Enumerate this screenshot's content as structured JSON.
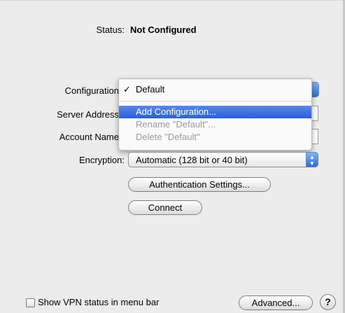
{
  "status": {
    "label": "Status:",
    "value": "Not Configured"
  },
  "form": {
    "configuration_label": "Configuration",
    "server_address_label": "Server Address",
    "account_name_label": "Account Name",
    "encryption_label": "Encryption:",
    "encryption_value": "Automatic (128 bit or 40 bit)"
  },
  "config_menu": {
    "items": [
      {
        "label": "Default",
        "checked": true,
        "enabled": true
      },
      {
        "label": "Add Configuration...",
        "highlighted": true,
        "enabled": true
      },
      {
        "label": "Rename \"Default\"...",
        "enabled": false
      },
      {
        "label": "Delete \"Default\"",
        "enabled": false
      }
    ],
    "check_glyph": "✓"
  },
  "buttons": {
    "auth_settings": "Authentication Settings...",
    "connect": "Connect",
    "advanced": "Advanced...",
    "help": "?"
  },
  "footer": {
    "show_vpn_status_label": "Show VPN status in menu bar",
    "show_vpn_status_checked": false
  },
  "colors": {
    "highlight": "#2c5fd9",
    "popup_arrow": "#2f6fd0"
  }
}
